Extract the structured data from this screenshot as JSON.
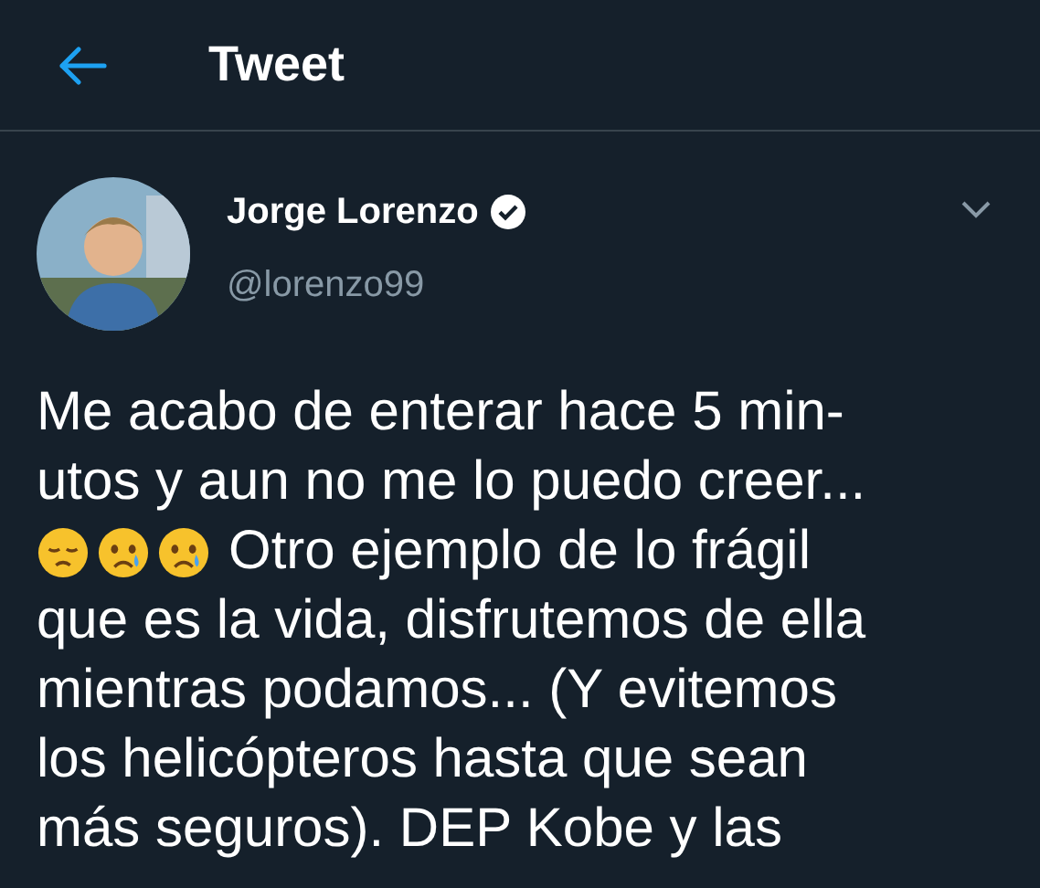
{
  "header": {
    "title": "Tweet"
  },
  "author": {
    "name": "Jorge Lorenzo",
    "verified": true,
    "handle": "@lorenzo99"
  },
  "tweet_lines": [
    {
      "kind": "text",
      "text": "Me acabo de enterar hace 5 min-"
    },
    {
      "kind": "text",
      "text": "utos y aun no me lo puedo creer..."
    },
    {
      "kind": "emoji_text",
      "text": "Otro ejemplo de lo frágil"
    },
    {
      "kind": "text",
      "text": "que es la vida, disfrutemos de ella"
    },
    {
      "kind": "text",
      "text": "mientras podamos... (Y evitemos"
    },
    {
      "kind": "text",
      "text": "los helicópteros hasta que sean"
    },
    {
      "kind": "text",
      "text": "más seguros). DEP Kobe y las"
    }
  ]
}
